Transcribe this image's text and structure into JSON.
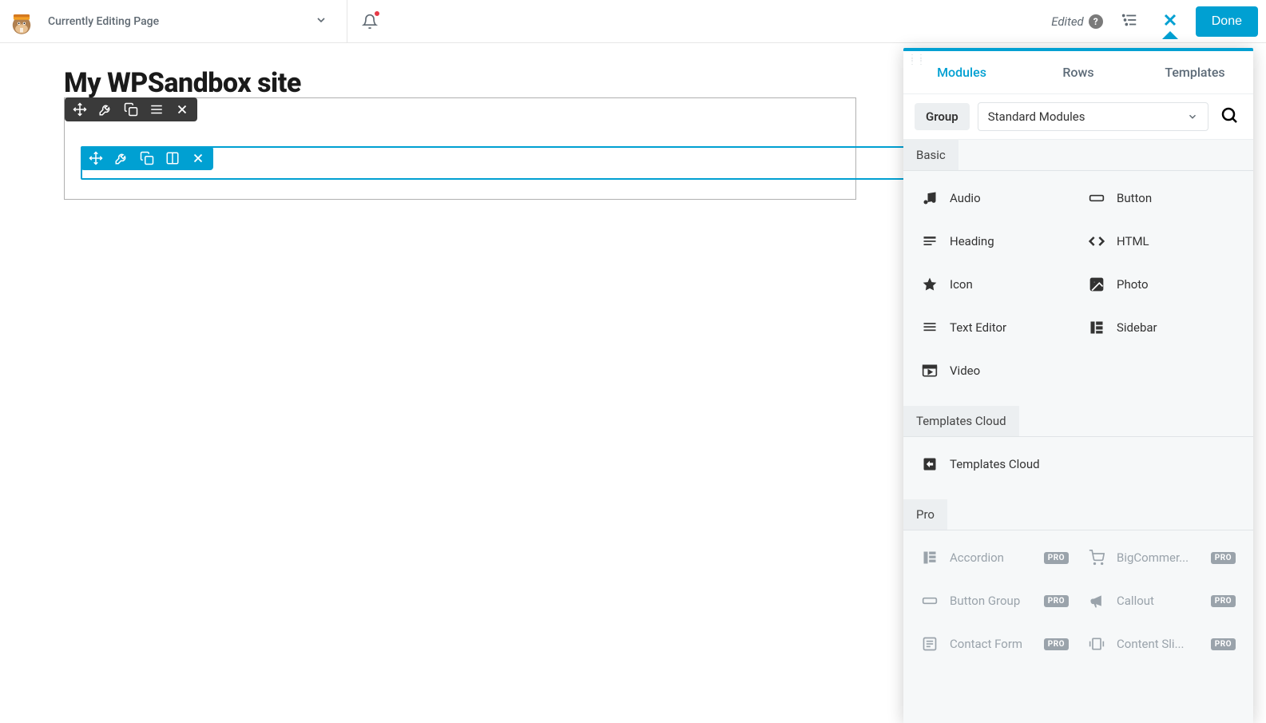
{
  "header": {
    "title_label": "Currently Editing Page",
    "edited_label": "Edited",
    "done_label": "Done"
  },
  "canvas": {
    "page_title": "My WPSandbox site"
  },
  "panel": {
    "tabs": {
      "modules": "Modules",
      "rows": "Rows",
      "templates": "Templates"
    },
    "group_label": "Group",
    "dropdown_value": "Standard Modules",
    "sections": {
      "basic": {
        "title": "Basic",
        "items": [
          "Audio",
          "Button",
          "Heading",
          "HTML",
          "Icon",
          "Photo",
          "Text Editor",
          "Sidebar",
          "Video"
        ]
      },
      "templates_cloud": {
        "title": "Templates Cloud",
        "items": [
          "Templates Cloud"
        ]
      },
      "pro": {
        "title": "Pro",
        "badge": "PRO",
        "items": [
          "Accordion",
          "BigCommer...",
          "Button Group",
          "Callout",
          "Contact Form",
          "Content Sli..."
        ]
      }
    }
  }
}
